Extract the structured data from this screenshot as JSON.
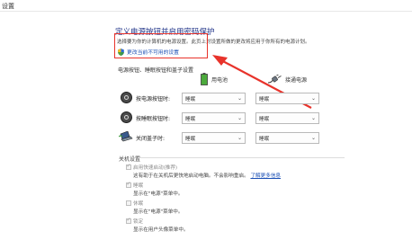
{
  "window": {
    "title": "设置"
  },
  "header": {
    "title": "定义电源按钮并启用密码保护",
    "description": "选择要为你的计算机的电源设置。此页上对设置所做的更改将应用于你所有的电源计划。",
    "change_link": "更改当前不可用的设置"
  },
  "power_buttons": {
    "section_title": "电源按钮、睡眠按钮和盖子设置",
    "column_battery": "用电池",
    "column_plugged": "接通电源",
    "rows": [
      {
        "label": "按电源按钮时:",
        "icon": "power-button-icon",
        "battery": "睡眠",
        "plugged": "睡眠"
      },
      {
        "label": "按睡眠按钮时:",
        "icon": "sleep-button-icon",
        "battery": "睡眠",
        "plugged": "睡眠"
      },
      {
        "label": "关闭盖子时:",
        "icon": "laptop-lid-icon",
        "battery": "睡眠",
        "plugged": "睡眠"
      }
    ]
  },
  "shutdown": {
    "section_title": "关机设置",
    "items": [
      {
        "label": "启用快速启动(推荐)",
        "checked": true,
        "sub": "这有助于在关机后更快地启动电脑。不会影响重启。",
        "link": "了解更多信息"
      },
      {
        "label": "睡眠",
        "checked": true,
        "sub": "显示在\"电源\"菜单中。"
      },
      {
        "label": "休眠",
        "checked": false,
        "sub": "显示在\"电源\"菜单中。"
      },
      {
        "label": "锁定",
        "checked": true,
        "sub": "显示在用户头像菜单中。"
      }
    ]
  },
  "colors": {
    "accent": "#1e3287",
    "link": "#1a4fb5",
    "annotation": "#e8332b"
  }
}
